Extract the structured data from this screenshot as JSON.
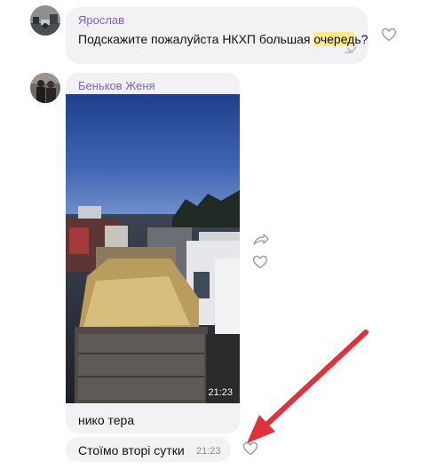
{
  "messages": [
    {
      "sender": "Ярослав",
      "text_before": "Подскажите пожалуйста НКХП большая ",
      "text_highlight": "очеред",
      "text_after": "ь?"
    },
    {
      "sender": "Беньков Женя",
      "photo_time": "21:23",
      "caption": "нико тера"
    },
    {
      "text": "Стоїмо вторі сутки",
      "time": "21:23"
    }
  ],
  "icons": {
    "like": "heart-outline-icon",
    "forward": "forward-arrow-icon",
    "reply": "reply-arrow-icon"
  },
  "colors": {
    "sender_name": "#7a63c9",
    "bubble_bg": "#f2f2f4",
    "highlight": "#fbe98a",
    "annotation_arrow": "#e0323a"
  }
}
